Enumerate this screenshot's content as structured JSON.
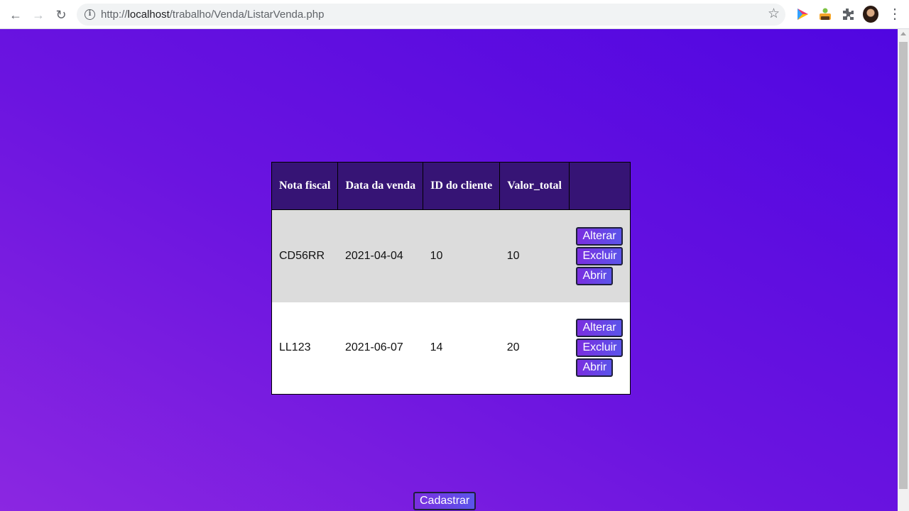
{
  "browser": {
    "url_prefix": "http://",
    "url_host": "localhost",
    "url_path": "/trabalho/Venda/ListarVenda.php",
    "icons": [
      "back-icon",
      "forward-icon",
      "reload-icon",
      "info-icon",
      "star-icon",
      "extensions-icon",
      "menu-icon"
    ]
  },
  "table": {
    "headers": [
      "Nota fiscal",
      "Data da venda",
      "ID do cliente",
      "Valor_total",
      ""
    ],
    "rows": [
      {
        "nota_fiscal": "CD56RR",
        "data_venda": "2021-04-04",
        "id_cliente": "10",
        "valor_total": "10"
      },
      {
        "nota_fiscal": "LL123",
        "data_venda": "2021-06-07",
        "id_cliente": "14",
        "valor_total": "20"
      }
    ],
    "actions": {
      "alterar": "Alterar",
      "excluir": "Excluir",
      "abrir": "Abrir"
    }
  },
  "cadastrar_label": "Cadastrar",
  "colors": {
    "header_bg": "#361475",
    "row_alt_bg": "#dcdcdc",
    "page_gradient_start": "#8b27e1",
    "page_gradient_end": "#5006e1"
  }
}
